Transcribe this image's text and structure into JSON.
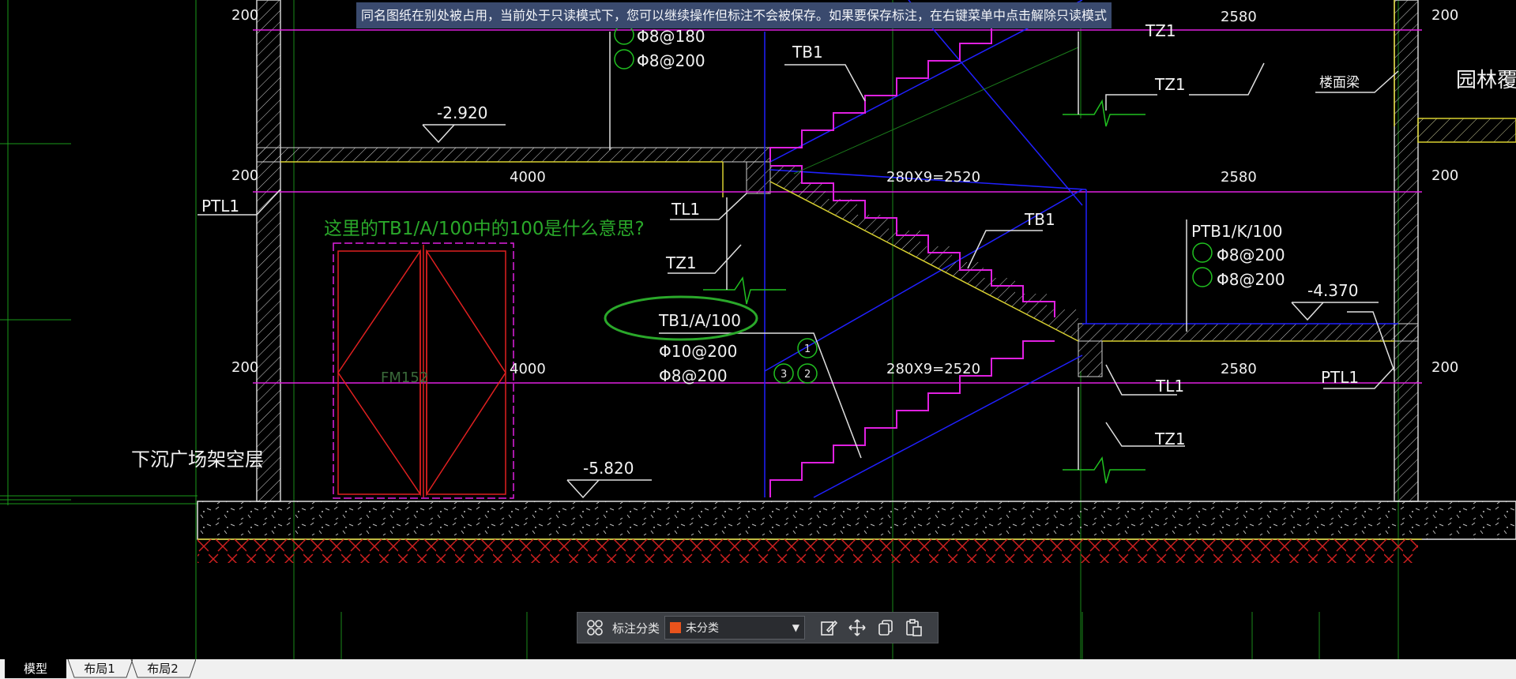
{
  "banner": {
    "text": "同名图纸在别处被占用，当前处于只读模式下，您可以继续操作但标注不会被保存。如果要保存标注，在右键菜单中点击解除只读模式"
  },
  "drawing": {
    "question": "这里的TB1/A/100中的100是什么意思?",
    "labels": {
      "tb1_top": "TB1",
      "tz1_top_right": "TZ1",
      "tz1_top_right_upper": "TZ1",
      "beam": "楼面梁",
      "garden": "园林覆土",
      "ptl1_left": "PTL1",
      "tl1_mid": "TL1",
      "tz1_mid": "TZ1",
      "tb1_mid": "TB1",
      "ptb1": "PTB1/K/100",
      "ptb1_r1": "Φ8@200",
      "ptb1_r2": "Φ8@200",
      "circled_tb1": "TB1/A/100",
      "rebar_main": "Φ10@200",
      "rebar_dist": "Φ8@200",
      "top_rebar_1": "Φ8@180",
      "top_rebar_2": "Φ8@200",
      "tl1_low": "TL1",
      "tz1_low": "TZ1",
      "ptl1_right": "PTL1",
      "sunken": "下沉广场架空层",
      "door": "FM152",
      "num1": "1",
      "num2": "2",
      "num3": "3"
    },
    "elevations": {
      "e1": "-2.920",
      "e2": "-4.370",
      "e3": "-5.820"
    },
    "dimensions": {
      "d200_a": "200",
      "d200_b": "200",
      "d200_c": "200",
      "d200_r1": "200",
      "d200_r2": "200",
      "d200_r3": "200",
      "d4000_a": "4000",
      "d4000_b": "4000",
      "d2580_a": "2580",
      "d2580_b": "2580",
      "d2580_c": "2580",
      "d2520_a": "280X9=2520",
      "d2520_b": "280X9=2520"
    }
  },
  "toolbar": {
    "category_label": "标注分类",
    "category_value": "未分类",
    "category_color": "#e8531c"
  },
  "tabs": [
    {
      "label": "模型",
      "active": true
    },
    {
      "label": "布局1",
      "active": false
    },
    {
      "label": "布局2",
      "active": false
    }
  ],
  "colors": {
    "background": "#000000",
    "magenta": "#e020e0",
    "blue": "#2020ff",
    "green": "#20c020",
    "yellow": "#d8d030",
    "red": "#e02020",
    "annotation_green": "#2aa82a"
  }
}
